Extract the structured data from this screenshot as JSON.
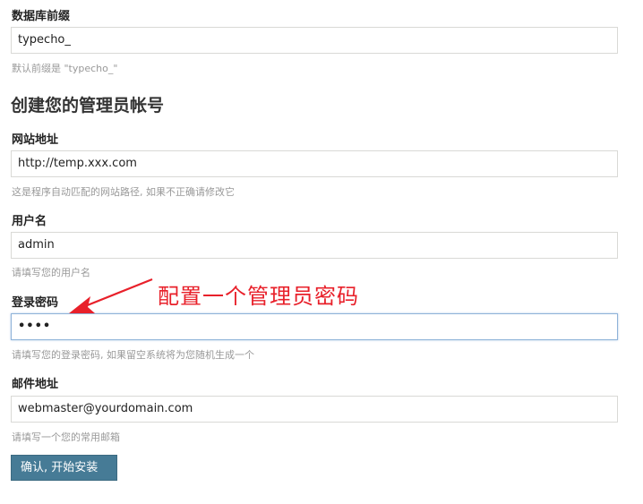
{
  "db_prefix": {
    "label": "数据库前缀",
    "value": "typecho_",
    "hint": "默认前缀是 \"typecho_\""
  },
  "admin_section": {
    "title": "创建您的管理员帐号"
  },
  "site_url": {
    "label": "网站地址",
    "value": "http://temp.xxx.com",
    "hint": "这是程序自动匹配的网站路径, 如果不正确请修改它"
  },
  "username": {
    "label": "用户名",
    "value": "admin",
    "hint": "请填写您的用户名"
  },
  "password": {
    "label": "登录密码",
    "value": "••••",
    "hint": "请填写您的登录密码, 如果留空系统将为您随机生成一个"
  },
  "email": {
    "label": "邮件地址",
    "value": "webmaster@yourdomain.com",
    "hint": "请填写一个您的常用邮箱"
  },
  "submit": {
    "label": "确认, 开始安装 »"
  },
  "annotation": {
    "text": "配置一个管理员密码",
    "color": "#e8202a"
  },
  "colors": {
    "button": "#467b96",
    "focus_border": "#8fb3d9"
  }
}
